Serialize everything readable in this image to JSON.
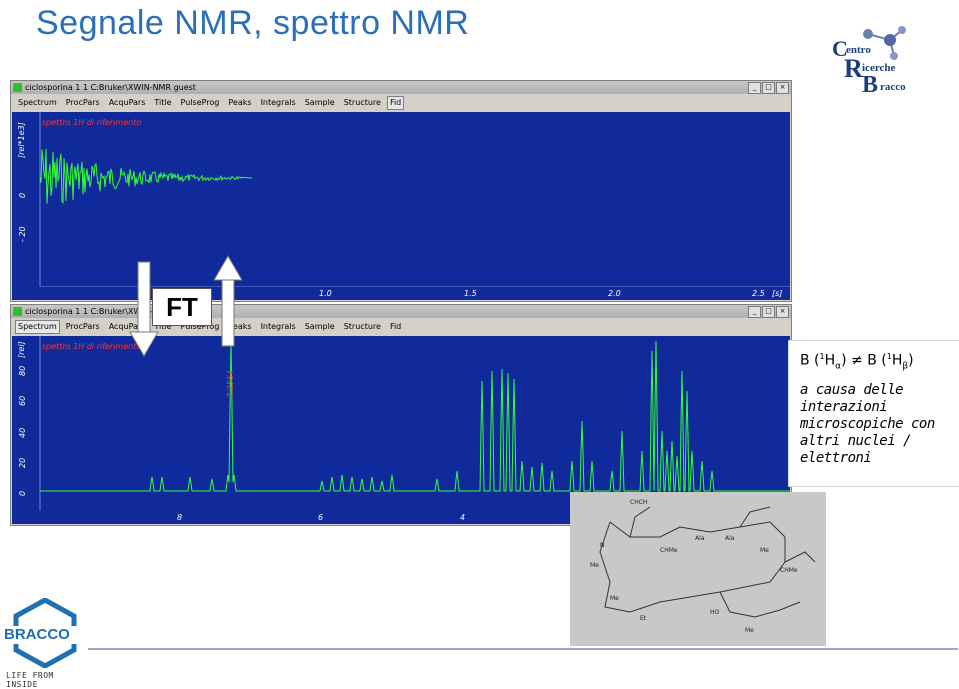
{
  "slide": {
    "title": "Segnale NMR, spettro NMR"
  },
  "logos": {
    "centro_ricerche_bracco": {
      "c": "C",
      "centro": "entro",
      "r": "R",
      "ricerche": "icerche",
      "b": "B",
      "bracco": "racco"
    },
    "bracco": {
      "word": "BRACCO",
      "tagline": "LIFE FROM INSIDE"
    }
  },
  "fid_window": {
    "title": "ciclosporina 1 1 C:Bruker\\XWIN-NMR guest",
    "tabs": [
      "Spectrum",
      "ProcPars",
      "AcquPars",
      "Title",
      "PulseProg",
      "Peaks",
      "Integrals",
      "Sample",
      "Structure",
      "Fid"
    ],
    "active_tab": "Fid",
    "caption": "spettro 1H di riferimento",
    "y_axis_label": "[rel*1e3]",
    "y_ticks": [
      "0",
      "- 20"
    ],
    "x_ticks": [
      "1.0",
      "1.5",
      "2.0",
      "2.5"
    ],
    "x_unit": "[s]"
  },
  "spectrum_window": {
    "title": "ciclosporina 1 1 C:Bruker\\XWIN-NMR",
    "tabs": [
      "Spectrum",
      "ProcPars",
      "AcquPars",
      "Title",
      "PulseProg",
      "Peaks",
      "Integrals",
      "Sample",
      "Structure",
      "Fid"
    ],
    "active_tab": "Spectrum",
    "caption": "spettro 1H di riferimento",
    "y_axis_label": "[rel]",
    "y_ticks": [
      "0",
      "20",
      "40",
      "60",
      "80"
    ],
    "x_ticks": [
      "8",
      "6",
      "4"
    ],
    "peak_label": "7.2564"
  },
  "ft_label": "FT",
  "formula": {
    "left_b": "B (",
    "left_sup": "1",
    "left_h": "H",
    "left_sub": "α",
    "neq": "≠",
    "right_b": "B (",
    "right_sup": "1",
    "right_h": "H",
    "right_sub": "β",
    "close": ")"
  },
  "description": "a causa delle interazioni microscopiche con altri nuclei / elettroni",
  "colors": {
    "title": "#2a6fb8",
    "plot_bg": "#102a9c",
    "signal": "#33ff33",
    "caption": "#ff3030"
  },
  "window_buttons": [
    "minimize-icon",
    "maximize-icon",
    "close-icon"
  ]
}
